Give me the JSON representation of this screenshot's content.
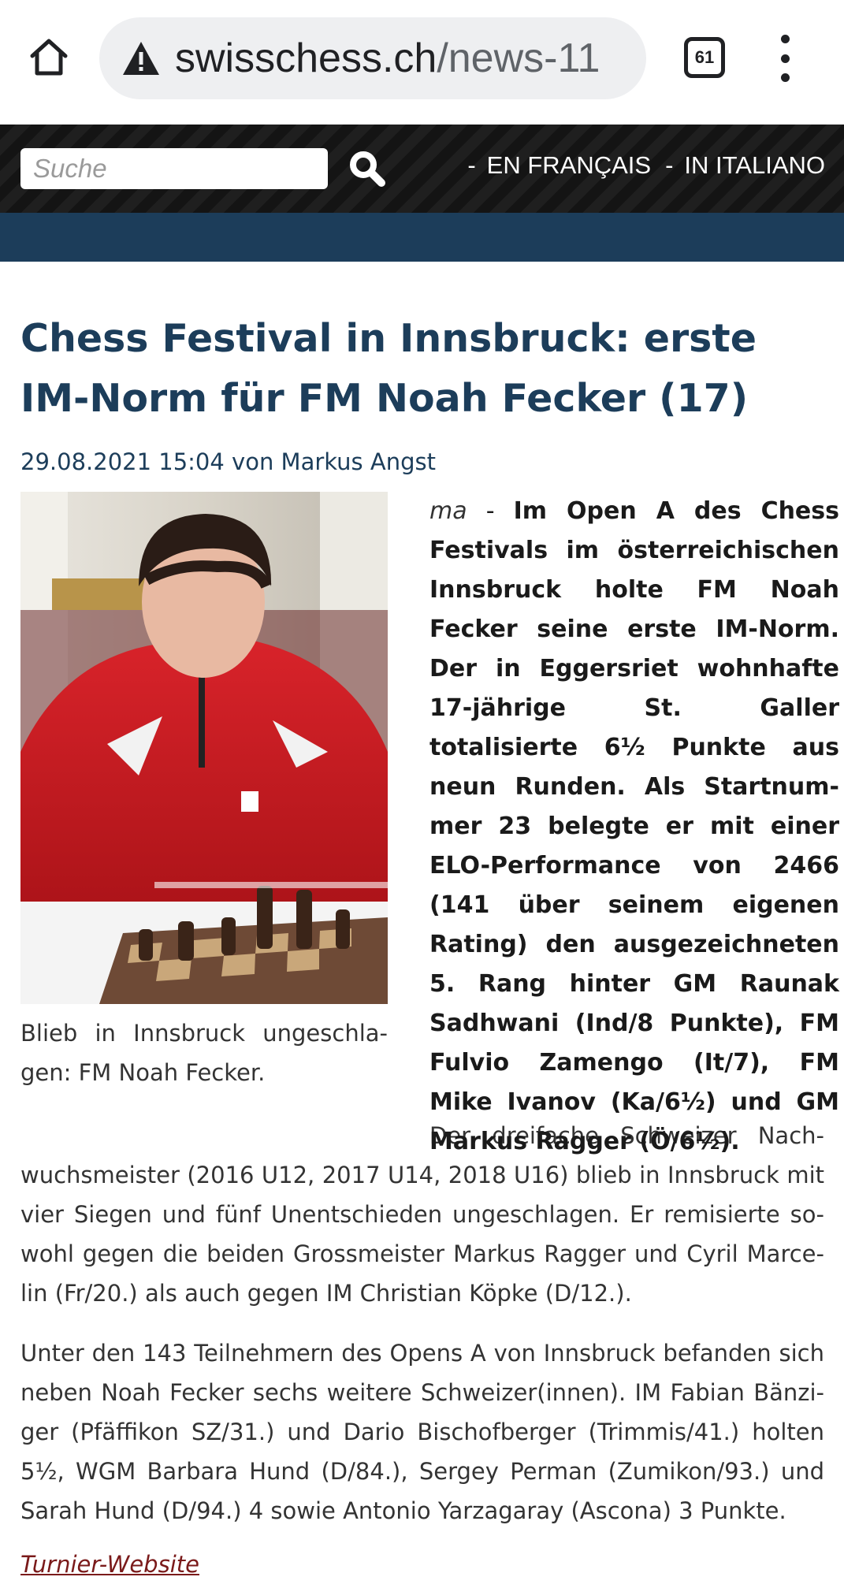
{
  "browser": {
    "url_host": "swisschess.ch",
    "url_path": "/news-11",
    "tab_count": "61",
    "icons": [
      "home-icon",
      "warning-icon",
      "tab-switcher-icon",
      "more-vert-icon"
    ]
  },
  "header": {
    "search_placeholder": "Suche",
    "search_icon": "magnifier-icon",
    "lang_separator": "-",
    "lang_links": [
      "EN FRANÇAIS",
      "IN ITALIANO"
    ]
  },
  "colors": {
    "brand_blue": "#1c3d5a",
    "link_red": "#7a1a1a",
    "header_black": "#141414"
  },
  "article": {
    "title": "Chess Festival in Innsbruck: erste IM-Norm für FM Noah Fecker (17)",
    "meta": "29.08.2021 15:04 von Markus Angst",
    "photo_caption": "Blieb in Innsbruck ungeschla­gen: FM Noah Fecker.",
    "lead_author": "ma",
    "lead_dash": " - ",
    "lead_text": "Im Open A des Chess Festi­vals im österreichischen Inns­bruck holte FM Noah Fecker seine erste IM-Norm. Der in Eg­gersriet wohnhafte 17-jährige St. Galler totalisierte 6½ Punkte aus neun Runden. Als Startnum­mer 23 belegte er mit einer ELO-Performance von 2466 (141 über seinem eigenen Rating) den ausgezeichneten 5. Rang hinter GM Raunak Sadhwani (Ind/8 Punkte), FM Fulvio Zamengo (It/7), FM Mike Ivanov (Ka/6½) und GM Markus Ragger (Ö/6½).",
    "paragraph_1": "Der dreifache Schweizer Nach­wuchsmeister (2016 U12, 2017 U14, 2018 U16) blieb in Innsbruck mit vier Siegen und fünf Unentschieden ungeschlagen. Er remisierte so­wohl gegen die beiden Grossmeister Markus Ragger und Cyril Marce­lin (Fr/20.) als auch gegen IM Christian Köpke (D/12.).",
    "paragraph_2": "Unter den 143 Teilnehmern des Opens A von Innsbruck befanden sich neben Noah Fecker sechs weitere Schweizer(innen). IM Fabian Bänzi­ger (Pfäffikon SZ/31.) und Dario Bischofberger (Trimmis/41.) holten 5½, WGM Barbara Hund (D/84.), Sergey Perman (Zumikon/93.) und Sarah Hund (D/94.) 4 sowie Antonio Yarzagaray (Ascona) 3 Punkte.",
    "link_text": "Turnier-Website"
  }
}
